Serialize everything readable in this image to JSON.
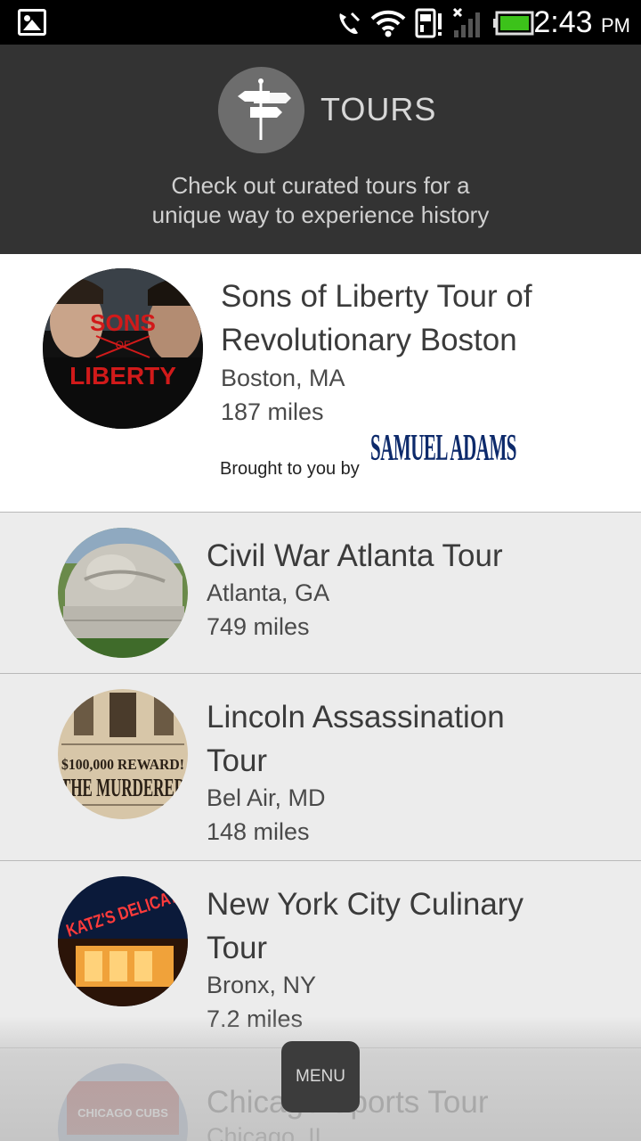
{
  "status_bar": {
    "time": "2:43",
    "ampm": "PM"
  },
  "header": {
    "title": "TOURS",
    "subtitle_line1": "Check out curated tours for a",
    "subtitle_line2": "unique way to experience history",
    "logo_icon": "signpost-icon"
  },
  "tours": [
    {
      "title_line1": "Sons of Liberty Tour of",
      "title_line2": "Revolutionary Boston",
      "location": "Boston, MA",
      "distance": "187 miles",
      "sponsor_label": "Brought to you by",
      "sponsor_logo": "SAMUEL ADAMS",
      "thumb_text_top": "SONS",
      "thumb_text_mid": "OF",
      "thumb_text_bottom": "LIBERTY"
    },
    {
      "title_line1": "Civil War Atlanta Tour",
      "location": "Atlanta, GA",
      "distance": "749 miles"
    },
    {
      "title_line1": "Lincoln Assassination",
      "title_line2": "Tour",
      "location": "Bel Air, MD",
      "distance": "148 miles",
      "thumb_text_reward": "$100,000 REWARD!",
      "thumb_text_murderer": "THE MURDERER"
    },
    {
      "title_line1": "New York City Culinary",
      "title_line2": "Tour",
      "location": "Bronx, NY",
      "distance": "7.2 miles",
      "thumb_text_sign": "KATZ'S DELICAT"
    },
    {
      "title_line1": "Chicago Sports Tour",
      "location": "Chicago, IL",
      "thumb_text_sign": "CHICAGO CUBS"
    }
  ],
  "menu": {
    "label": "MENU"
  },
  "colors": {
    "status_bar": "#000000",
    "header_bg": "#333333",
    "list_bg": "#ececec",
    "featured_bg": "#ffffff",
    "sponsor_blue": "#0d2a6b",
    "battery_green": "#3cc21a"
  }
}
